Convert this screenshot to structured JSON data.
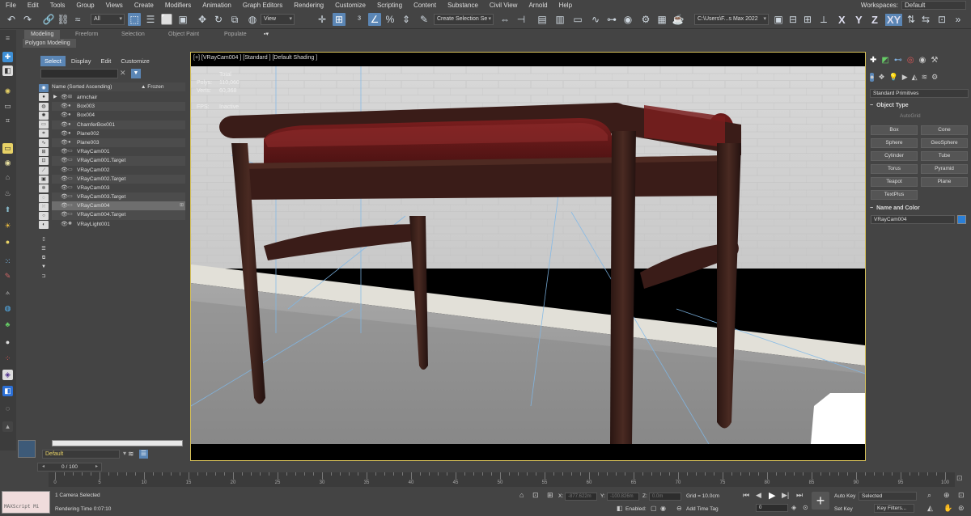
{
  "menu": [
    "File",
    "Edit",
    "Tools",
    "Group",
    "Views",
    "Create",
    "Modifiers",
    "Animation",
    "Graph Editors",
    "Rendering",
    "Customize",
    "Scripting",
    "Content",
    "Substance",
    "Civil View",
    "Arnold",
    "Help"
  ],
  "workspaces": {
    "label": "Workspaces:",
    "value": "Default"
  },
  "toolbar": {
    "filter_value": "All",
    "view_value": "View",
    "selection_set_placeholder": "Create Selection Se",
    "path_value": "C:\\Users\\F...s Max 2022",
    "axis_x": "X",
    "axis_y": "Y",
    "axis_z": "Z",
    "axis_xy": "XY"
  },
  "ribbon": {
    "tabs": [
      "Modeling",
      "Freeform",
      "Selection",
      "Object Paint",
      "Populate"
    ],
    "active_tab": "Modeling",
    "sub_label": "Polygon Modeling"
  },
  "scene_explorer": {
    "tabs": [
      "Select",
      "Display",
      "Edit",
      "Customize"
    ],
    "active_tab": "Select",
    "col_name": "Name (Sorted Ascending)",
    "col_frozen": "▲ Frozen",
    "items": [
      {
        "name": "armchair",
        "icon": "group-icon",
        "expand": true
      },
      {
        "name": "Box003",
        "icon": "geometry-icon"
      },
      {
        "name": "Box004",
        "icon": "geometry-icon"
      },
      {
        "name": "ChamferBox001",
        "icon": "geometry-icon"
      },
      {
        "name": "Plane002",
        "icon": "geometry-icon"
      },
      {
        "name": "Plane003",
        "icon": "geometry-icon"
      },
      {
        "name": "VRayCam001",
        "icon": "camera-icon"
      },
      {
        "name": "VRayCam001.Target",
        "icon": "camera-icon"
      },
      {
        "name": "VRayCam002",
        "icon": "camera-icon"
      },
      {
        "name": "VRayCam002.Target",
        "icon": "camera-icon"
      },
      {
        "name": "VRayCam003",
        "icon": "camera-icon"
      },
      {
        "name": "VRayCam003.Target",
        "icon": "camera-icon"
      },
      {
        "name": "VRayCam004",
        "icon": "camera-icon",
        "selected": true
      },
      {
        "name": "VRayCam004.Target",
        "icon": "camera-icon"
      },
      {
        "name": "VRayLight001",
        "icon": "light-icon"
      }
    ],
    "layer_value": "Default"
  },
  "viewport": {
    "label": "[+] [VRayCam004 ] [Standard ] [Default Shading ]",
    "stats_total": "Total",
    "stats_polys_label": "Polys:",
    "stats_polys": "110,060",
    "stats_verts_label": "Verts:",
    "stats_verts": "60,368",
    "stats_fps_label": "FPS:",
    "stats_fps": "Inactive"
  },
  "command_panel": {
    "category": "Standard Primitives",
    "object_type_title": "Object Type",
    "autogrid": "AutoGrid",
    "buttons": [
      "Box",
      "Cone",
      "Sphere",
      "GeoSphere",
      "Cylinder",
      "Tube",
      "Torus",
      "Pyramid",
      "Teapot",
      "Plane",
      "TextPlus"
    ],
    "name_color_title": "Name and Color",
    "object_name": "VRayCam004",
    "object_color": "#2b7fd6"
  },
  "timeline": {
    "frame_display": "0 / 100",
    "ticks": [
      "0",
      "5",
      "10",
      "15",
      "20",
      "25",
      "30",
      "35",
      "40",
      "45",
      "50",
      "55",
      "60",
      "65",
      "70",
      "75",
      "80",
      "85",
      "90",
      "95",
      "100"
    ]
  },
  "status": {
    "maxscript": "MAXScript Mi",
    "selected": "1 Camera Selected",
    "render_time": "Rendering Time  0:07:10",
    "x_label": "X:",
    "x_value": "-877.622m",
    "y_label": "Y:",
    "y_value": "-100.826m",
    "z_label": "Z:",
    "z_value": "0.0m",
    "grid": "Grid = 10.0cm",
    "enabled_label": "Enabled:",
    "add_time_tag": "Add Time Tag",
    "auto_key": "Auto Key",
    "set_key": "Set Key",
    "selected_dd": "Selected",
    "key_filters": "Key Filters...",
    "frame_value": "0"
  },
  "colors": {
    "accent": "#5b86b5",
    "viewport_border": "#d8c25a"
  }
}
